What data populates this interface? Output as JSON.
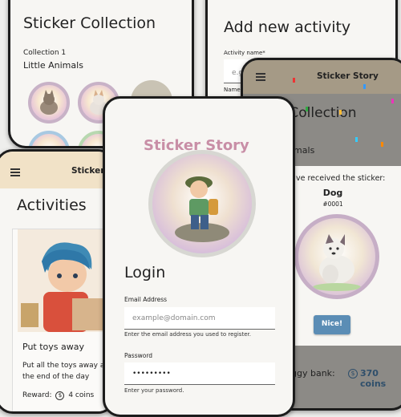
{
  "collection_screen": {
    "title": "Sticker Collection",
    "collection_number": "Collection 1",
    "collection_name": "Little Animals"
  },
  "activity_screen": {
    "title": "Add new activity",
    "activity_name_label": "Activity name*",
    "activity_name_placeholder": "e.g.",
    "name_label": "Name o"
  },
  "activities_screen": {
    "app_title": "Sticker",
    "title": "Activities",
    "card_title": "Put toys away",
    "card_description": "Put all the toys away at the end of the day",
    "reward_label": "Reward:",
    "reward_value": "4 coins"
  },
  "login_screen": {
    "logo_text": "Sticker Story",
    "title": "Login",
    "email_label": "Email Address",
    "email_placeholder": "example@domain.com",
    "email_help": "Enter the email address you used to register.",
    "password_label": "Password",
    "password_value": "•••••••••",
    "password_help": "Enter your password."
  },
  "reward_screen": {
    "app_title": "Sticker Story",
    "bg_title": "r Collection",
    "bg_subtitle": "imals",
    "dialog_message": "ve received the sticker:",
    "sticker_name": "Dog",
    "sticker_number": "#0001",
    "nice_button": "Nice!",
    "piggy_bank_label": "ggy bank:",
    "coin_count": "370 coins"
  },
  "colors": {
    "accent_blue": "#5b8db5",
    "logo_gradient_start": "#b07cc6",
    "logo_gradient_end": "#e0b070",
    "appbar": "#f1e2c7"
  }
}
